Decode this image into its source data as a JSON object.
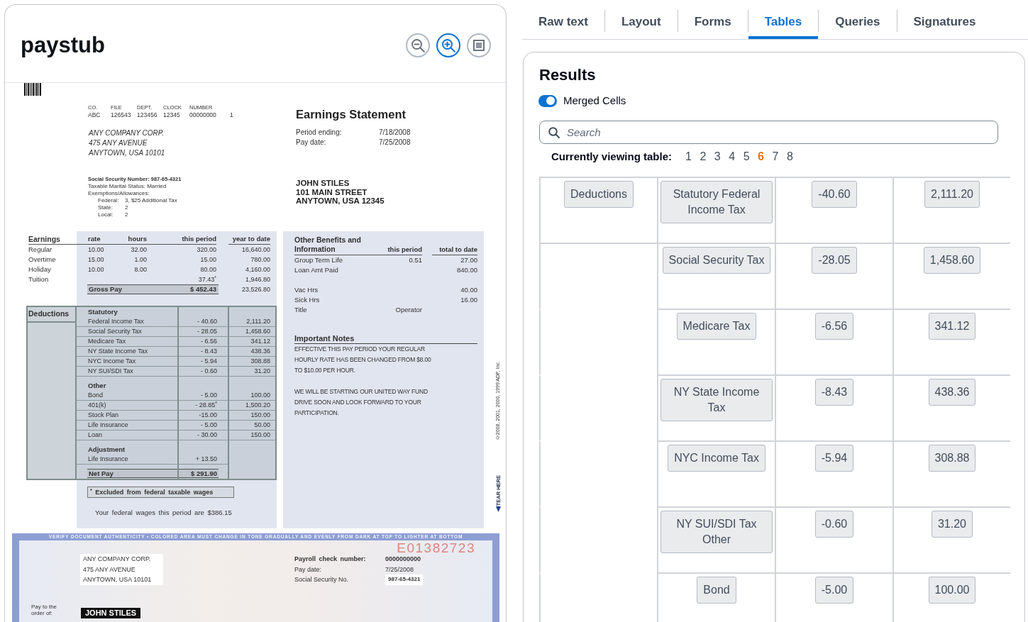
{
  "viewer": {
    "title": "paystub",
    "tools": [
      {
        "kind": "zoom_out",
        "selected": false
      },
      {
        "kind": "zoom_in",
        "selected": true
      },
      {
        "kind": "fit",
        "selected": false
      }
    ]
  },
  "document": {
    "id_labels": [
      "CO.",
      "FILE",
      "DEPT.",
      "CLOCK",
      "NUMBER"
    ],
    "id_values": [
      "ABC",
      "126543",
      "123456",
      "12345",
      "00000000",
      "1"
    ],
    "company": [
      "ANY COMPANY CORP.",
      "475 ANY AVENUE",
      "ANYTOWN, USA 10101"
    ],
    "tax_status": {
      "ssn": "Social Security Number: 987-65-4321",
      "marital": "Taxable Marital Status: Married",
      "exemptions": "Exemptions/Allowances:",
      "allowances": [
        {
          "label": "Federal:",
          "value": "3, $25 Additional Tax"
        },
        {
          "label": "State:",
          "value": "2"
        },
        {
          "label": "Local:",
          "value": "2"
        }
      ]
    },
    "statement_title": "Earnings Statement",
    "dates": [
      {
        "label": "Period ending:",
        "value": "7/18/2008"
      },
      {
        "label": "Pay date:",
        "value": "7/25/2008"
      }
    ],
    "employee": [
      "JOHN STILES",
      "101 MAIN STREET",
      "ANYTOWN, USA 12345"
    ],
    "earnings": {
      "columns": [
        "Earnings",
        "rate",
        "hours",
        "this period",
        "year to date"
      ],
      "rows": [
        {
          "type": "Regular",
          "rate": "10.00",
          "hours": "32.00",
          "this_period": "320.00",
          "year_to_date": "16,640.00"
        },
        {
          "type": "Overtime",
          "rate": "15.00",
          "hours": "1.00",
          "this_period": "15.00",
          "year_to_date": "780.00"
        },
        {
          "type": "Holiday",
          "rate": "10.00",
          "hours": "8.00",
          "this_period": "80.00",
          "year_to_date": "4,160.00"
        },
        {
          "type": "Tuition",
          "this_period": "37.43$^{*}$",
          "year_to_date": "1,946.80"
        }
      ],
      "gross": {
        "label": "Gross Pay",
        "this_period": "$ 452.43",
        "year_to_date": "23,526.80"
      }
    },
    "deductions": {
      "title": "Deductions",
      "sections": [
        {
          "title": "Statutory",
          "rows": [
            {
              "name": "Federal Income Tax",
              "this_period": "- 40.60",
              "year_to_date": "2,111.20"
            },
            {
              "name": "Social Security Tax",
              "this_period": "- 28.05",
              "year_to_date": "1,458.60"
            },
            {
              "name": "Medicare Tax",
              "this_period": "- 6.56",
              "year_to_date": "341.12"
            },
            {
              "name": "NY State Income Tax",
              "this_period": "- 8.43",
              "year_to_date": "438.36"
            },
            {
              "name": "NYC Income Tax",
              "this_period": "- 5.94",
              "year_to_date": "308.88"
            },
            {
              "name": "NY SUI/SDI Tax",
              "this_period": "- 0.60",
              "year_to_date": "31.20"
            }
          ]
        },
        {
          "title": "Other",
          "rows": [
            {
              "name": "Bond",
              "this_period": "- 5.00",
              "year_to_date": "100.00"
            },
            {
              "name": "401(k)",
              "this_period": "- 28.85$^{*}$",
              "year_to_date": "1,500.20"
            },
            {
              "name": "Stock Plan",
              "this_period": "-15.00",
              "year_to_date": "150.00"
            },
            {
              "name": "Life Insurance",
              "this_period": "- 5.00",
              "year_to_date": "50.00"
            },
            {
              "name": "Loan",
              "this_period": "- 30.00",
              "year_to_date": "150.00"
            }
          ]
        },
        {
          "title": "Adjustment",
          "rows": [
            {
              "name": "Life Insurance",
              "this_period": "+ 13.50"
            }
          ]
        }
      ],
      "net_pay": {
        "label": "Net Pay",
        "value": "$ 291.90"
      }
    },
    "footnote": "$^{*}$ Excluded from federal taxable wages",
    "federal_wages": "Your federal wages this period are $386.15",
    "benefits": {
      "title": "Other Benefits and Information",
      "columns": [
        "this period",
        "total to date"
      ],
      "groups": [
        [
          {
            "label": "Group Term Life",
            "this_period": "0.51",
            "total_to_date": "27.00"
          },
          {
            "label": "Loan Amt Paid",
            "total_to_date": "840.00"
          }
        ],
        [
          {
            "label": "Vac Hrs",
            "total_to_date": "40.00"
          },
          {
            "label": "Sick Hrs",
            "total_to_date": "16.00"
          },
          {
            "label": "Title",
            "this_period": "Operator"
          }
        ]
      ]
    },
    "notes": {
      "title": "Important Notes",
      "paragraphs": [
        [
          "EFFECTIVE THIS PAY PERIOD YOUR REGULAR",
          "HOURLY RATE HAS BEEN CHANGED FROM $8.00",
          "TO $10.00 PER HOUR."
        ],
        [
          "WE WILL BE STARTING OUR UNITED WAY FUND",
          "DRIVE SOON AND LOOK FORWARD TO YOUR",
          "PARTICIPATION."
        ]
      ]
    },
    "copyright": "©2008, 2001, 2000, 1999 ADP, Inc.",
    "tear_label": "TEAR HERE",
    "check": {
      "security_text": "VERIFY DOCUMENT AUTHENTICITY • COLORED AREA MUST CHANGE IN TONE GRADUALLY AND EVENLY FROM DARK AT TOP TO LIGHTER AT BOTTOM",
      "serial": "E01382723",
      "company": [
        "ANY COMPANY CORP.",
        "475 ANY AVENUE",
        "ANYTOWN, USA 10101"
      ],
      "details": [
        {
          "label": "Payroll check number:",
          "value": "0000000000"
        },
        {
          "label": "Pay date:",
          "value": "7/25/2008"
        },
        {
          "label": "Social Security No.",
          "value": "987-65-4321"
        }
      ],
      "payee_label": "Pay to the order of:",
      "payee": "JOHN STILES"
    }
  },
  "tabs": [
    {
      "label": "Raw text",
      "selected": false
    },
    {
      "label": "Layout",
      "selected": false
    },
    {
      "label": "Forms",
      "selected": false
    },
    {
      "label": "Tables",
      "selected": true
    },
    {
      "label": "Queries",
      "selected": false
    },
    {
      "label": "Signatures",
      "selected": false
    }
  ],
  "results": {
    "title": "Results",
    "merged_cells": {
      "label": "Merged Cells",
      "on": true
    },
    "search": {
      "placeholder": "Search"
    },
    "table_picker": {
      "label": "Currently viewing table:",
      "tables": [
        {
          "label": "1",
          "selected": false
        },
        {
          "label": "2",
          "selected": false
        },
        {
          "label": "3",
          "selected": false
        },
        {
          "label": "4",
          "selected": false
        },
        {
          "label": "5",
          "selected": false
        },
        {
          "label": "6",
          "selected": true
        },
        {
          "label": "7",
          "selected": false
        },
        {
          "label": "8",
          "selected": false
        }
      ]
    },
    "table": {
      "rows": [
        {
          "lead": {
            "text": "Deductions",
            "merged_above": false
          },
          "cells": [
            "Statutory Federal Income Tax",
            "-40.60",
            "2,111.20"
          ]
        },
        {
          "lead": {
            "merged_above": false
          },
          "cells": [
            "Social Security Tax",
            "-28.05",
            "1,458.60"
          ]
        },
        {
          "lead": {
            "merged_above": true
          },
          "cells": [
            "Medicare Tax",
            "-6.56",
            "341.12"
          ]
        },
        {
          "lead": {
            "merged_above": true
          },
          "cells": [
            "NY State Income Tax",
            "-8.43",
            "438.36"
          ]
        },
        {
          "lead": {
            "merged_above": true
          },
          "cells": [
            "NYC Income Tax",
            "-5.94",
            "308.88"
          ]
        },
        {
          "lead": {
            "merged_above": true
          },
          "cells": [
            "NY SUI/SDI Tax Other",
            "-0.60",
            "31.20"
          ]
        },
        {
          "lead": {
            "merged_above": true
          },
          "cells": [
            "Bond",
            "-5.00",
            "100.00"
          ]
        }
      ]
    }
  }
}
